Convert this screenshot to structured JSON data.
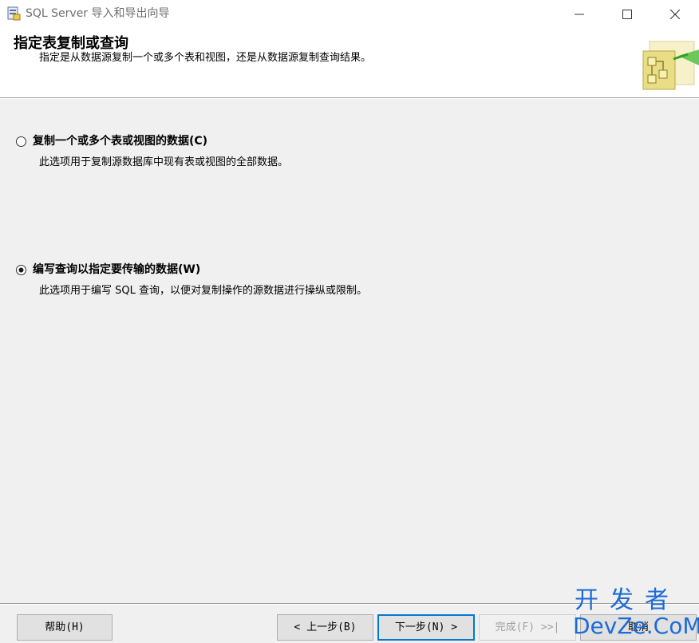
{
  "window": {
    "title": "SQL Server 导入和导出向导",
    "app_icon": "wizard-app-icon",
    "controls": [
      "minimize-icon",
      "maximize-icon",
      "close-icon"
    ]
  },
  "header": {
    "title": "指定表复制或查询",
    "subtitle": "指定是从数据源复制一个或多个表和视图，还是从数据源复制查询结果。",
    "graphic": "table-copy-wizard-icon"
  },
  "options": [
    {
      "label": "复制一个或多个表或视图的数据(C)",
      "description": "此选项用于复制源数据库中现有表或视图的全部数据。",
      "selected": false
    },
    {
      "label": "编写查询以指定要传输的数据(W)",
      "description": "此选项用于编写 SQL 查询，以便对复制操作的源数据进行操纵或限制。",
      "selected": true
    }
  ],
  "footer": {
    "help": "帮助(H)",
    "back": "< 上一步(B)",
    "next": "下一步(N) >",
    "finish": "完成(F) >>|",
    "cancel": "取消"
  },
  "watermark": {
    "top": "开发者",
    "bottom": "DevZe.CoM"
  },
  "colors": {
    "accent": "#0078d7",
    "watermark": "#1e6bd6"
  }
}
